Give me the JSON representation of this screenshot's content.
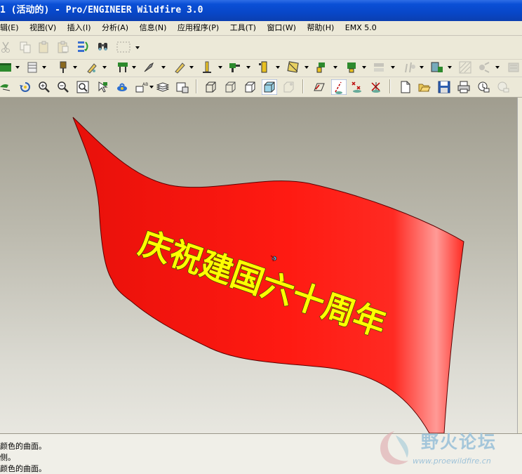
{
  "window": {
    "title": "1 (活动的) - Pro/ENGINEER Wildfire 3.0"
  },
  "menu": [
    {
      "name": "menu-edit",
      "label": "辑(E)"
    },
    {
      "name": "menu-view",
      "label": "视图(V)"
    },
    {
      "name": "menu-insert",
      "label": "插入(I)"
    },
    {
      "name": "menu-analysis",
      "label": "分析(A)"
    },
    {
      "name": "menu-info",
      "label": "信息(N)"
    },
    {
      "name": "menu-applications",
      "label": "应用程序(P)"
    },
    {
      "name": "menu-tools",
      "label": "工具(T)"
    },
    {
      "name": "menu-window",
      "label": "窗口(W)"
    },
    {
      "name": "menu-help",
      "label": "帮助(H)"
    },
    {
      "name": "menu-emx",
      "label": "EMX 5.0"
    }
  ],
  "model": {
    "banner_text": "庆祝建国六十周年",
    "flag_color": "#ff1a12",
    "text_color": "#ffff00"
  },
  "messages": [
    "颜色的曲面。",
    "侧。",
    "颜色的曲面。"
  ],
  "watermark": {
    "name": "野火论坛",
    "url": "www.proewildfire.cn"
  }
}
